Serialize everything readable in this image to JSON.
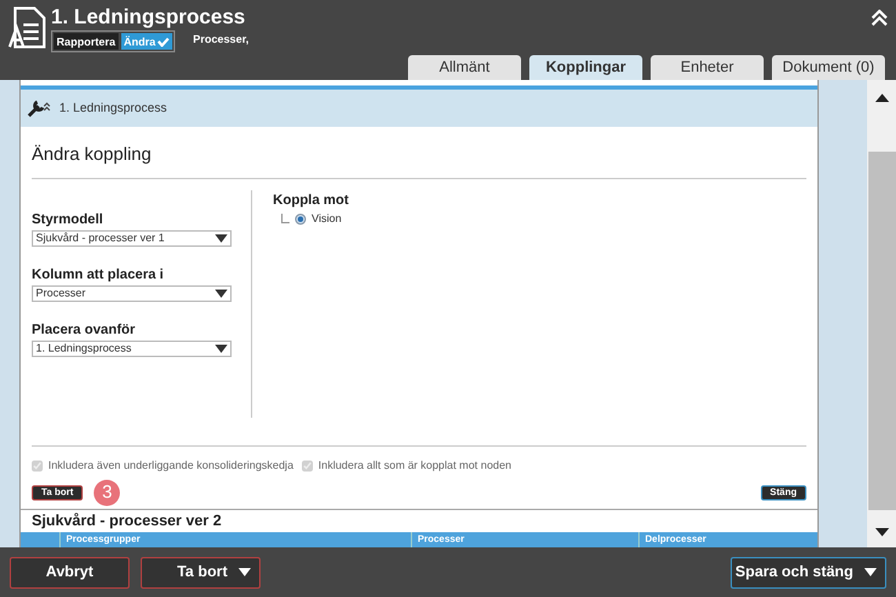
{
  "header": {
    "title": "1. Ledningsprocess",
    "modes": [
      {
        "label": "Rapportera",
        "selected": false
      },
      {
        "label": "Ändra",
        "selected": true
      }
    ],
    "breadcrumb": "Processer,"
  },
  "tabs": [
    {
      "label": "Allmänt",
      "selected": false
    },
    {
      "label": "Kopplingar",
      "selected": true
    },
    {
      "label": "Enheter",
      "selected": false
    },
    {
      "label": "Dokument (0)",
      "selected": false
    }
  ],
  "node_row": {
    "label": "1. Ledningsprocess"
  },
  "dialog": {
    "title": "Ändra koppling",
    "fields": [
      {
        "label": "Styrmodell",
        "value": "Sjukvård - processer ver 1"
      },
      {
        "label": "Kolumn att placera i",
        "value": "Processer"
      },
      {
        "label": "Placera ovanför",
        "value": "1. Ledningsprocess"
      }
    ],
    "connect": {
      "label": "Koppla mot",
      "tree": [
        {
          "label": "Vision",
          "selected": true
        }
      ]
    },
    "options": [
      {
        "label": "Inkludera även underliggande konsolideringskedja",
        "checked": true,
        "disabled": true
      },
      {
        "label": "Inkludera allt som är kopplat mot noden",
        "checked": true,
        "disabled": true
      }
    ],
    "delete_button": "Ta bort",
    "badge": "3",
    "close_button": "Stäng"
  },
  "next_section": {
    "title": "Sjukvård - processer ver 2",
    "columns": [
      "Processgrupper",
      "Processer",
      "Delprocesser"
    ]
  },
  "footer": {
    "cancel": "Avbryt",
    "delete": "Ta bort",
    "save": "Spara och stäng"
  }
}
